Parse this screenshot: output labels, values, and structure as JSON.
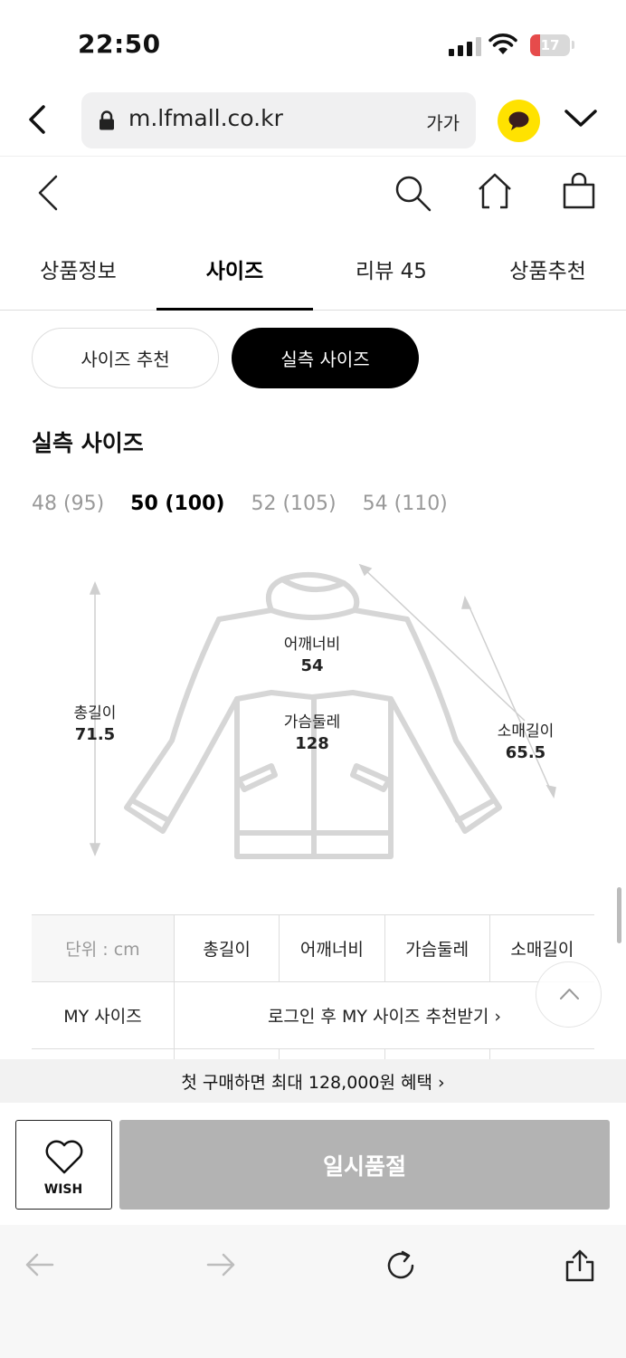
{
  "status_bar": {
    "time": "22:50",
    "battery": "17",
    "battery_level": 0.17
  },
  "browser": {
    "url": "m.lfmall.co.kr",
    "text_size_button": "가가"
  },
  "tabs": [
    {
      "label": "상품정보",
      "active": false
    },
    {
      "label": "사이즈",
      "active": true
    },
    {
      "label": "리뷰 45",
      "active": false
    },
    {
      "label": "상품추천",
      "active": false
    }
  ],
  "size_toggle": {
    "recommend_label": "사이즈 추천",
    "actual_label": "실측 사이즈"
  },
  "section_title": "실측 사이즈",
  "size_options": [
    {
      "label": "48 (95)",
      "selected": false
    },
    {
      "label": "50 (100)",
      "selected": true
    },
    {
      "label": "52 (105)",
      "selected": false
    },
    {
      "label": "54 (110)",
      "selected": false
    }
  ],
  "diagram": {
    "total_length": {
      "label": "총길이",
      "value": "71.5"
    },
    "shoulder": {
      "label": "어깨너비",
      "value": "54"
    },
    "chest": {
      "label": "가슴둘레",
      "value": "128"
    },
    "sleeve": {
      "label": "소매길이",
      "value": "65.5"
    }
  },
  "table": {
    "unit_label": "단위 : cm",
    "headers": [
      "총길이",
      "어깨너비",
      "가슴둘레",
      "소매길이"
    ],
    "my_size_label": "MY 사이즈",
    "my_size_cta": "로그인 후 MY 사이즈 추천받기 ›"
  },
  "benefit_text": "첫 구매하면 최대 128,000원 혜택 ›",
  "wish_label": "WISH",
  "soldout_label": "일시품절",
  "colors": {
    "brand_yellow": "#ffe200",
    "soldout_gray": "#b3b3b3",
    "battery_red": "#e64b4b"
  }
}
